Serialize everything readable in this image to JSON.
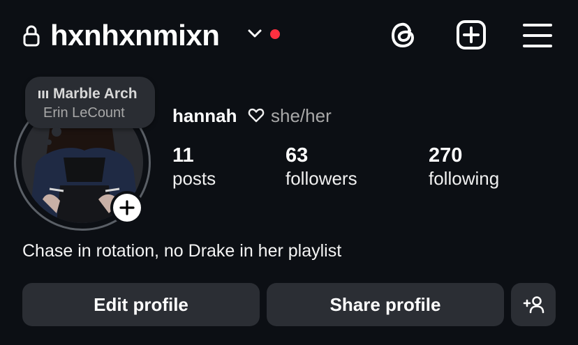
{
  "header": {
    "username": "hxnhxnmixn",
    "icons": [
      "lock-icon",
      "chevron-down-icon",
      "threads-icon",
      "new-post-icon",
      "menu-icon"
    ],
    "notification_dot_color": "#ff3040"
  },
  "note": {
    "song": "Marble Arch",
    "artist": "Erin LeCount"
  },
  "profile": {
    "name": "hannah",
    "pronouns": "she/her"
  },
  "stats": {
    "posts": {
      "count": "11",
      "label": "posts"
    },
    "followers": {
      "count": "63",
      "label": "followers"
    },
    "following": {
      "count": "270",
      "label": "following"
    }
  },
  "bio": "Chase in rotation, no Drake in her playlist",
  "actions": {
    "edit_label": "Edit profile",
    "share_label": "Share profile"
  },
  "colors": {
    "background": "#0c0f14",
    "button": "#2b2e34",
    "secondary_text": "#a8a8a8"
  }
}
